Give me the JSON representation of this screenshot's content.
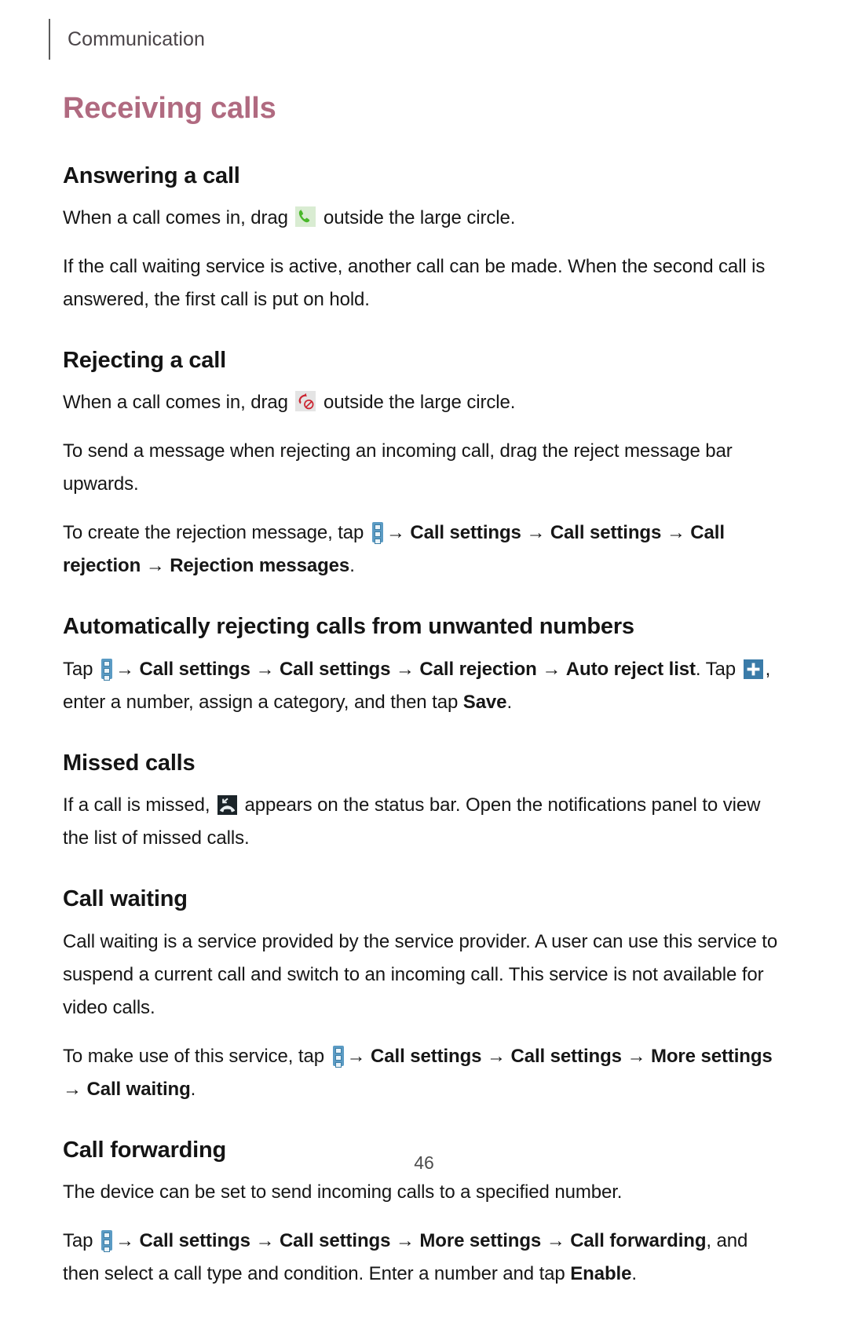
{
  "header": {
    "running_head": "Communication"
  },
  "title": "Receiving calls",
  "sections": {
    "answering": {
      "heading": "Answering a call",
      "p1_before": "When a call comes in, drag",
      "p1_after": "outside the large circle.",
      "p2": "If the call waiting service is active, another call can be made. When the second call is answered, the first call is put on hold."
    },
    "rejecting": {
      "heading": "Rejecting a call",
      "p1_before": "When a call comes in, drag",
      "p1_after": "outside the large circle.",
      "p2": "To send a message when rejecting an incoming call, drag the reject message bar upwards.",
      "p3_lead": "To create the rejection message, tap",
      "p3_step1": "Call settings",
      "p3_step2": "Call settings",
      "p3_step3": "Call rejection",
      "p3_step4": "Rejection messages",
      "p3_end": "."
    },
    "auto_reject": {
      "heading": "Automatically rejecting calls from unwanted numbers",
      "p1_lead": "Tap",
      "p1_step1": "Call settings",
      "p1_step2": "Call settings",
      "p1_step3": "Call rejection",
      "p1_step4": "Auto reject list",
      "p1_mid": ". Tap",
      "p1_after_plus": ", enter a number, assign a category, and then tap",
      "p1_bold_end": "Save",
      "p1_end": "."
    },
    "missed": {
      "heading": "Missed calls",
      "p1_before": "If a call is missed,",
      "p1_after": "appears on the status bar. Open the notifications panel to view the list of missed calls."
    },
    "call_waiting": {
      "heading": "Call waiting",
      "p1": "Call waiting is a service provided by the service provider. A user can use this service to suspend a current call and switch to an incoming call. This service is not available for video calls.",
      "p2_lead": "To make use of this service, tap",
      "p2_step1": "Call settings",
      "p2_step2": "Call settings",
      "p2_step3": "More settings",
      "p2_step4": "Call waiting",
      "p2_end": "."
    },
    "call_forwarding": {
      "heading": "Call forwarding",
      "p1": "The device can be set to send incoming calls to a specified number.",
      "p2_lead": "Tap",
      "p2_step1": "Call settings",
      "p2_step2": "Call settings",
      "p2_step3": "More settings",
      "p2_step4": "Call forwarding",
      "p2_after": ", and then select a call type and condition. Enter a number and tap",
      "p2_bold_end": "Enable",
      "p2_end": "."
    }
  },
  "icons": {
    "answer_call": "answer-call-icon",
    "reject_call": "reject-call-icon",
    "menu_key": "more-options-menu-icon",
    "add": "add-plus-icon",
    "missed_call": "missed-call-status-icon"
  },
  "colors": {
    "title": "#b06a80",
    "answer_green": "#49b82a",
    "reject_red": "#cc2430",
    "menu_blue": "#5b9bc4",
    "plus_blue": "#3a7ba8",
    "missed_dark": "#1b2429"
  },
  "arrow": "→",
  "footer": {
    "page_number": "46"
  }
}
